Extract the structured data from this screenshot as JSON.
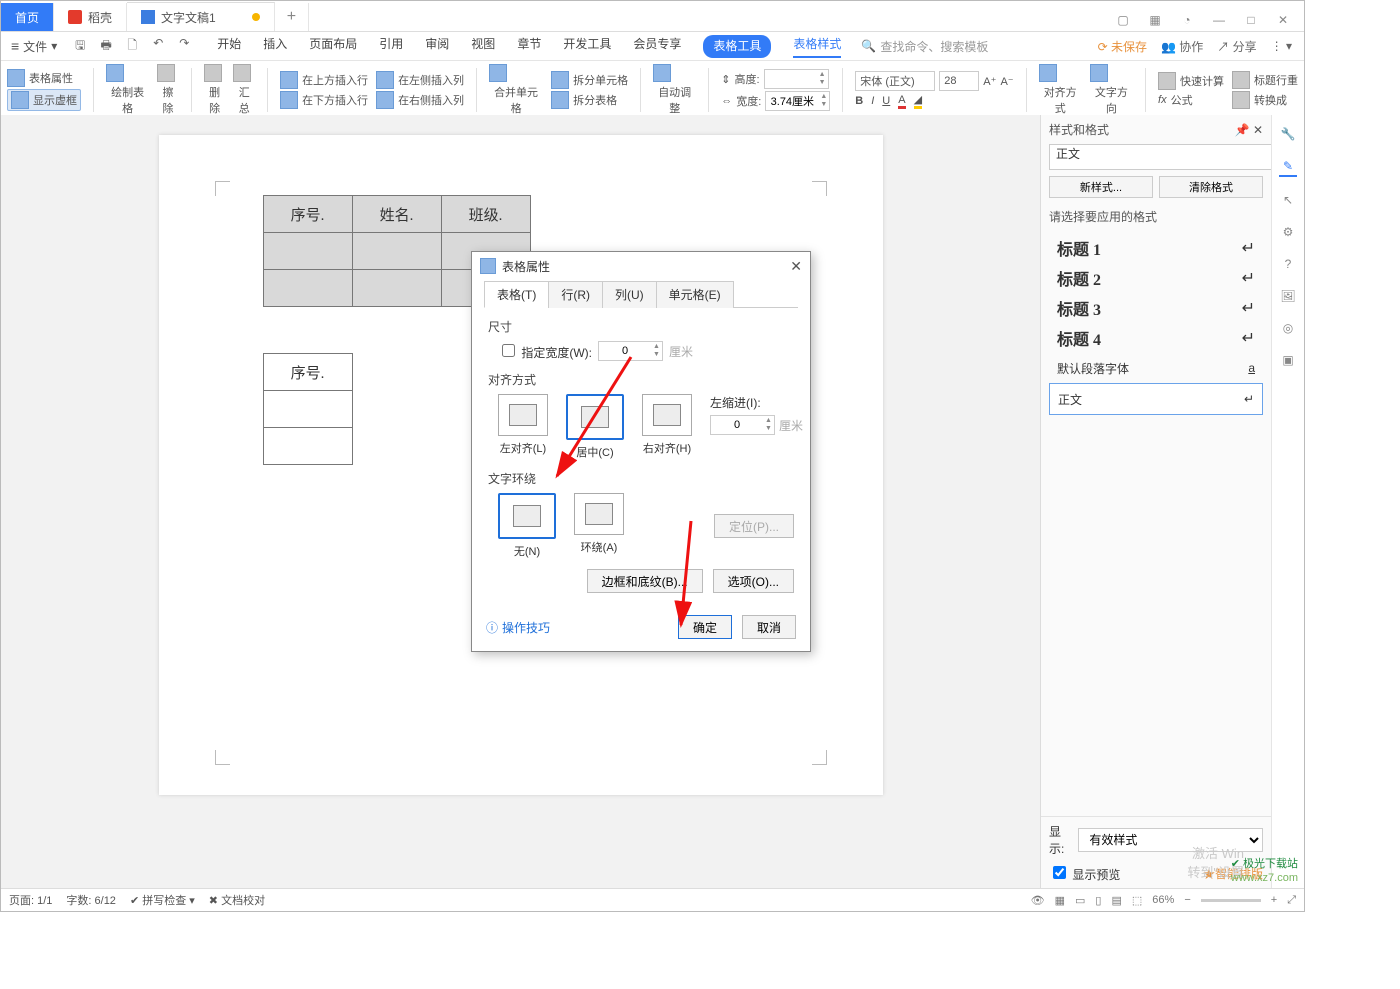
{
  "tabs": {
    "home": "首页",
    "shell": "稻壳",
    "doc": "文字文稿1"
  },
  "file_label": "文件",
  "menus": [
    "开始",
    "插入",
    "页面布局",
    "引用",
    "审阅",
    "视图",
    "章节",
    "开发工具",
    "会员专享"
  ],
  "menu_pill": "表格工具",
  "menu_styletab": "表格样式",
  "search_ph": "查找命令、搜索模板",
  "top_right": {
    "unsaved": "未保存",
    "coop": "协作",
    "share": "分享"
  },
  "ribbon": {
    "tblprop": "表格属性",
    "showframe": "显示虚框",
    "drawtbl": "绘制表格",
    "erase": "擦除",
    "delete": "删除",
    "summary": "汇总",
    "ins_above": "在上方插入行",
    "ins_below": "在下方插入行",
    "ins_left": "在左侧插入列",
    "ins_right": "在右侧插入列",
    "merge": "合并单元格",
    "split_cell": "拆分单元格",
    "split_tbl": "拆分表格",
    "autofit": "自动调整",
    "height_l": "高度:",
    "width_l": "宽度:",
    "width_v": "3.74厘米",
    "font": "宋体 (正文)",
    "fsize": "28",
    "align": "对齐方式",
    "textdir": "文字方向",
    "fastcalc": "快速计算",
    "titlerow": "标题行重",
    "formula": "公式",
    "convert": "转换成"
  },
  "table1": {
    "h1": "序号.",
    "h2": "姓名.",
    "h3": "班级."
  },
  "table2": {
    "h1": "序号."
  },
  "dlg": {
    "title": "表格属性",
    "tabs": {
      "t": "表格(T)",
      "r": "行(R)",
      "c": "列(U)",
      "e": "单元格(E)"
    },
    "size": "尺寸",
    "specw": "指定宽度(W):",
    "specw_v": "0",
    "specw_u": "厘米",
    "align": "对齐方式",
    "a_l": "左对齐(L)",
    "a_c": "居中(C)",
    "a_r": "右对齐(H)",
    "ind_l": "左缩进(I):",
    "ind_v": "0",
    "ind_u": "厘米",
    "wrap": "文字环绕",
    "w_none": "无(N)",
    "w_around": "环绕(A)",
    "pos": "定位(P)...",
    "border": "边框和底纹(B)...",
    "options": "选项(O)...",
    "help": "操作技巧",
    "ok": "确定",
    "cancel": "取消"
  },
  "panel": {
    "title": "样式和格式",
    "current": "正文",
    "newstyle": "新样式...",
    "clear": "清除格式",
    "choose": "请选择要应用的格式",
    "items": [
      "标题 1",
      "标题 2",
      "标题 3",
      "标题 4"
    ],
    "default": "默认段落字体",
    "normal": "正文",
    "show_l": "显示:",
    "show_v": "有效样式",
    "preview": "显示预览",
    "smart": "智能排版"
  },
  "status": {
    "page": "页面: 1/1",
    "words": "字数: 6/12",
    "spell": "拼写检查",
    "proof": "文档校对",
    "zoom": "66%"
  },
  "act": {
    "l1": "激活 Win",
    "l2": "转到\"设置"
  },
  "wm": {
    "l1": "极光下载站",
    "l2": "www.xz7.com"
  }
}
